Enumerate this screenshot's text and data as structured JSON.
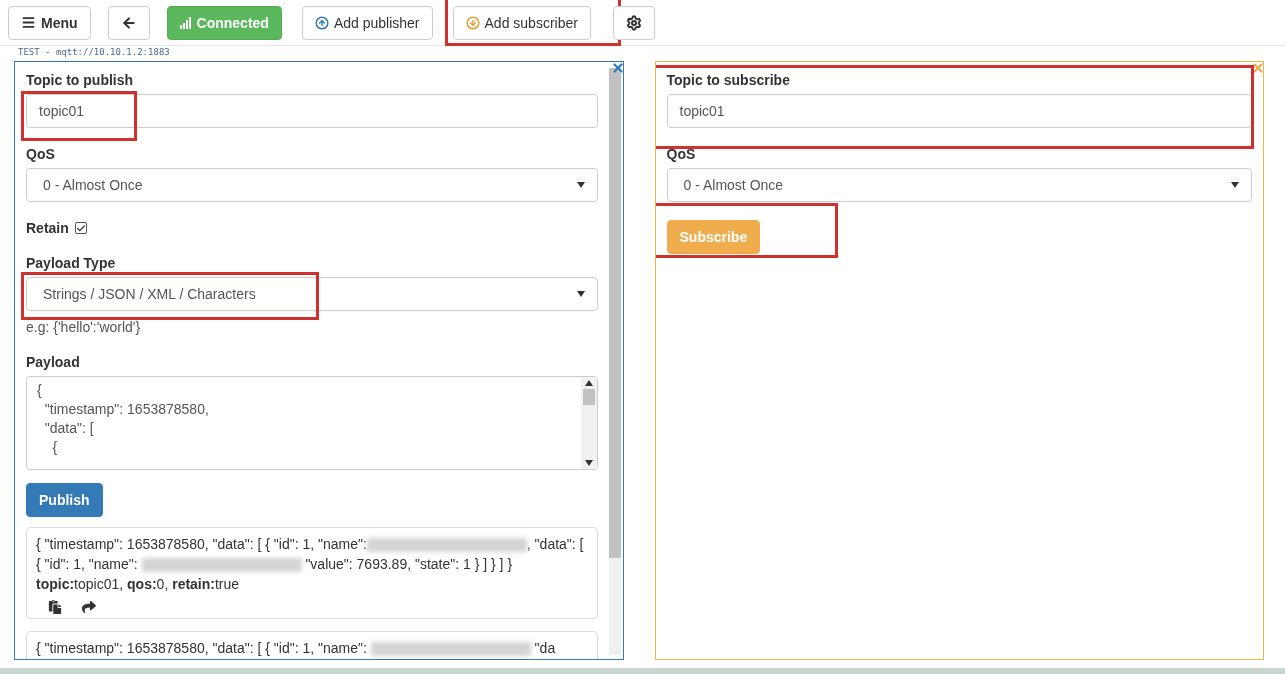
{
  "toolbar": {
    "buttons": [
      {
        "kind": "menu",
        "label": "Menu",
        "highlighted": false
      },
      {
        "kind": "back",
        "highlighted": false
      },
      {
        "kind": "connected",
        "label": "Connected",
        "highlighted": false
      },
      {
        "kind": "add-publisher",
        "label": "Add publisher",
        "highlighted": false
      },
      {
        "kind": "add-subscriber",
        "label": "Add subscriber",
        "highlighted": true
      },
      {
        "kind": "settings",
        "highlighted": false
      }
    ]
  },
  "connection": "TEST - mqtt://10.10.1.2:1883",
  "publisher": {
    "topic_label": "Topic to publish",
    "topic": "topic01",
    "topic_highlighted": true,
    "qos_label": "QoS",
    "qos": "0 - Almost Once",
    "retain_label": "Retain",
    "retain_checked": true,
    "payload_type_label": "Payload Type",
    "payload_type": "Strings / JSON / XML / Characters",
    "payload_type_highlighted": true,
    "payload_type_hint": "e.g: {'hello':'world'}",
    "payload_label": "Payload",
    "payload_lines": [
      "{",
      "  \"timestamp\": 1653878580,",
      "  \"data\": [",
      "    {"
    ],
    "publish_button": "Publish",
    "messages": [
      {
        "segments": [
          {
            "kind": "text",
            "text": "{ \"timestamp\": 1653878580, \"data\": [ { \"id\": 1, \"name\":"
          },
          {
            "kind": "redacted"
          },
          {
            "kind": "text",
            "text": ", \"data\": [ { \"id\": 1, \"name\": "
          },
          {
            "kind": "redacted"
          },
          {
            "kind": "text",
            "text": " \"value\": 7693.89, \"state\": 1 } ] } ] }"
          }
        ],
        "meta": "**topic:**topic01, **qos:**0, **retain:**true"
      },
      {
        "segments": [
          {
            "kind": "text",
            "text": "{ \"timestamp\": 1653878580, \"data\": [ { \"id\": 1, \"name\": "
          },
          {
            "kind": "redacted"
          },
          {
            "kind": "text",
            "text": " \"da"
          }
        ]
      }
    ]
  },
  "subscriber": {
    "topic_label": "Topic to subscribe",
    "topic": "topic01",
    "topic_highlighted": true,
    "qos_label": "QoS",
    "qos": "0 - Almost Once",
    "subscribe_button": "Subscribe",
    "subscribe_highlighted": true
  }
}
